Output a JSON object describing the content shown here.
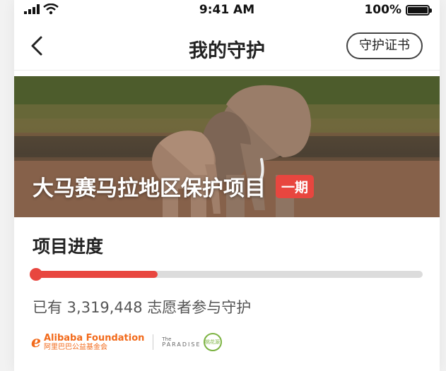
{
  "status_bar": {
    "time": "9:41 AM",
    "battery": "100%"
  },
  "nav": {
    "title": "我的守护",
    "certificate_button": "守护证书"
  },
  "project": {
    "title": "大马赛马拉地区保护项目",
    "phase_badge": "一期"
  },
  "progress": {
    "section_title": "项目进度",
    "fraction": 0.32,
    "volunteers_text": "已有 3,319,448 志愿者参与守护"
  },
  "partners": {
    "alibaba_mark": "e",
    "alibaba_name": "Alibaba Foundation",
    "alibaba_sub": "阿里巴巴公益基金会",
    "paradise_the": "The",
    "paradise_name": "PARADISE",
    "paradise_ring": "桃花源"
  },
  "colors": {
    "accent": "#e8463f",
    "track": "#dcdcdc",
    "alibaba": "#f26a1b",
    "paradise": "#7cb342"
  },
  "icons": [
    "back-arrow-icon",
    "signal-icon",
    "wifi-icon",
    "battery-icon"
  ]
}
